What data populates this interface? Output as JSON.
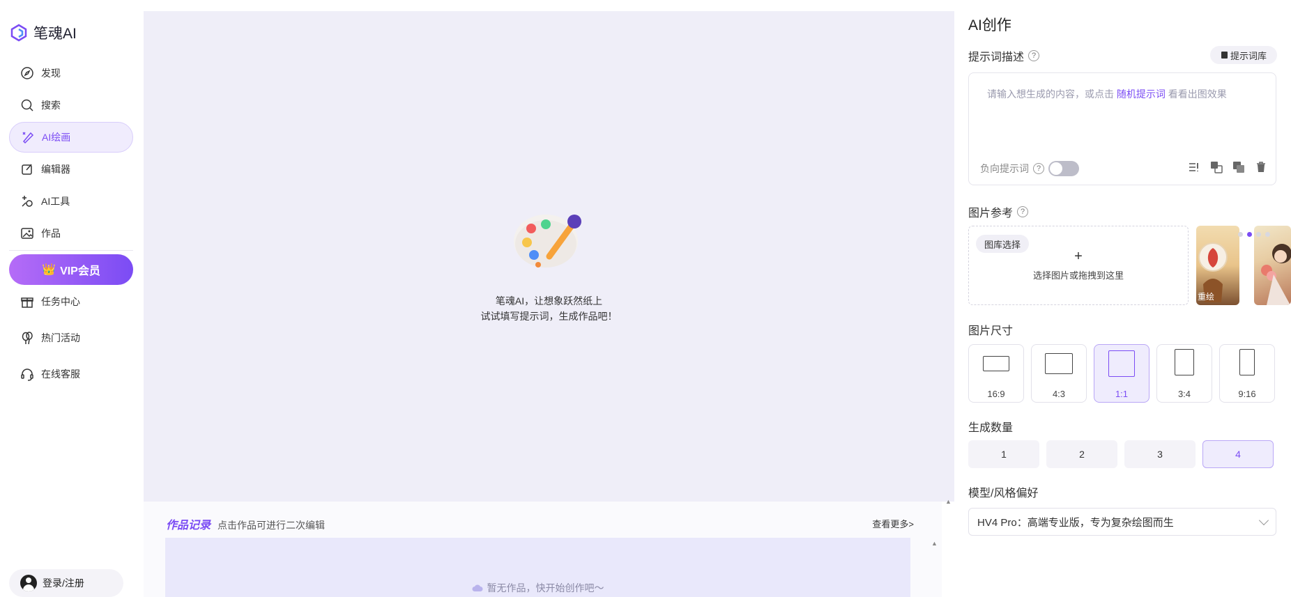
{
  "sidebar": {
    "logo_text": "笔魂AI",
    "nav": [
      {
        "label": "发现",
        "icon": "discover-icon"
      },
      {
        "label": "搜索",
        "icon": "search-icon"
      },
      {
        "label": "AI绘画",
        "icon": "ai-paint-icon",
        "active": true
      },
      {
        "label": "编辑器",
        "icon": "editor-icon"
      },
      {
        "label": "AI工具",
        "icon": "ai-tools-icon"
      },
      {
        "label": "作品",
        "icon": "works-icon"
      }
    ],
    "vip_label": "VIP会员",
    "nav2": [
      {
        "label": "任务中心",
        "icon": "gift-icon"
      },
      {
        "label": "热门活动",
        "icon": "balloon-icon"
      },
      {
        "label": "在线客服",
        "icon": "headset-icon"
      }
    ],
    "login_label": "登录/注册"
  },
  "main": {
    "empty_line1": "笔魂AI，让想象跃然纸上",
    "empty_line2": "试试填写提示词，生成作品吧！"
  },
  "records": {
    "title": "作品记录",
    "subtitle": "点击作品可进行二次编辑",
    "more": "查看更多>",
    "empty": "暂无作品，快开始创作吧～"
  },
  "panel": {
    "title": "AI创作",
    "prompt_label": "提示词描述",
    "lib_button": "提示词库",
    "placeholder_prefix": "请输入想生成的内容，或点击",
    "placeholder_link": "随机提示词",
    "placeholder_suffix": "看看出图效果",
    "negative_label": "负向提示词",
    "ref_label": "图片参考",
    "gallery_button": "图库选择",
    "ref_plus": "+",
    "ref_hint": "选择图片或拖拽到这里",
    "thumb_label": "重绘",
    "size_label": "图片尺寸",
    "sizes": [
      {
        "label": "16:9"
      },
      {
        "label": "4:3"
      },
      {
        "label": "1:1",
        "active": true
      },
      {
        "label": "3:4"
      },
      {
        "label": "9:16"
      }
    ],
    "count_label": "生成数量",
    "counts": [
      "1",
      "2",
      "3",
      "4"
    ],
    "count_active": "4",
    "model_label": "模型/风格偏好",
    "model_value": "HV4 Pro：高端专业版，专为复杂绘图而生"
  },
  "colors": {
    "accent": "#7b4cf4",
    "canvas_bg": "#efeef8",
    "vip_gradient_start": "#b56cf7"
  }
}
